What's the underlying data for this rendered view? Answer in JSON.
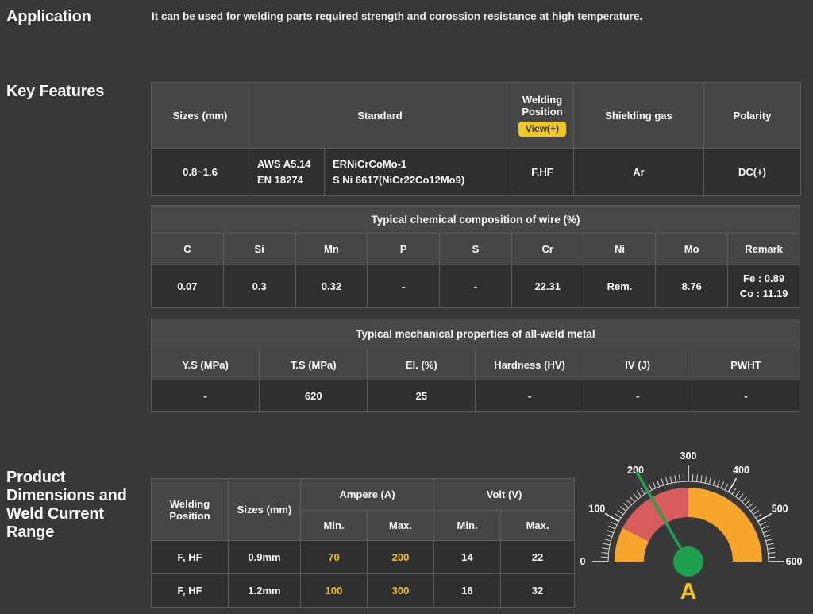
{
  "colors": {
    "page_bg": "#383838",
    "header_bg": "#464646",
    "cell_bg": "#2f2f2f",
    "border": "#5c5c5c",
    "accent_yellow": "#f2c31d",
    "badge_bg": "#f2c918",
    "badge_text": "#2b2b2b"
  },
  "application": {
    "title": "Application",
    "description": "It can be used for welding parts required strength and corossion resistance at high temperature."
  },
  "key_features": {
    "title": "Key Features",
    "spec_table": {
      "headers": {
        "sizes": "Sizes (mm)",
        "standard": "Standard",
        "welding_position": "Welding Position",
        "view_button": "View(+)",
        "shielding_gas": "Shielding gas",
        "polarity": "Polarity"
      },
      "row": {
        "sizes": "0.8~1.6",
        "standard_codes": [
          "AWS A5.14",
          "EN 18274"
        ],
        "standard_names": [
          "ERNiCrCoMo-1",
          "S Ni 6617(NiCr22Co12Mo9)"
        ],
        "welding_position": "F,HF",
        "shielding_gas": "Ar",
        "polarity": "DC(+)"
      }
    },
    "chemical_table": {
      "title": "Typical chemical composition of wire (%)",
      "columns": [
        "C",
        "Si",
        "Mn",
        "P",
        "S",
        "Cr",
        "Ni",
        "Mo",
        "Remark"
      ],
      "values": [
        "0.07",
        "0.3",
        "0.32",
        "-",
        "-",
        "22.31",
        "Rem.",
        "8.76"
      ],
      "remark_lines": [
        "Fe : 0.89",
        "Co : 11.19"
      ]
    },
    "mechanical_table": {
      "title": "Typical mechanical properties of all-weld metal",
      "columns": [
        "Y.S (MPa)",
        "T.S (MPa)",
        "El. (%)",
        "Hardness (HV)",
        "IV (J)",
        "PWHT"
      ],
      "values": [
        "-",
        "620",
        "25",
        "-",
        "-",
        "-"
      ]
    }
  },
  "product_dimensions": {
    "title": "Product Dimensions and Weld Current Range",
    "current_table": {
      "headers": {
        "welding_position": "Welding Position",
        "sizes": "Sizes (mm)",
        "ampere_group": "Ampere (A)",
        "volt_group": "Volt (V)",
        "min": "Min.",
        "max": "Max."
      },
      "rows": [
        {
          "position": "F, HF",
          "size": "0.9mm",
          "ampere_min": "70",
          "ampere_max": "200",
          "volt_min": "14",
          "volt_max": "22"
        },
        {
          "position": "F, HF",
          "size": "1.2mm",
          "ampere_min": "100",
          "ampere_max": "300",
          "volt_min": "16",
          "volt_max": "32"
        }
      ]
    },
    "gauge": {
      "type": "gauge",
      "unit": "A",
      "min": 0,
      "max": 600,
      "value": 200,
      "minor_step": 10,
      "major_step": 100,
      "labels": [
        "0",
        "100",
        "200",
        "300",
        "400",
        "500",
        "600"
      ],
      "zones": [
        {
          "from": 0,
          "to": 90,
          "color": "#f5a62b"
        },
        {
          "from": 90,
          "to": 300,
          "color": "#d95c5c"
        },
        {
          "from": 300,
          "to": 600,
          "color": "#f5a62b"
        }
      ],
      "needle_color": "#22a14f",
      "hub_color": "#1b9e4d",
      "label_color": "#ffffff",
      "unit_color": "#f2c31d"
    }
  }
}
